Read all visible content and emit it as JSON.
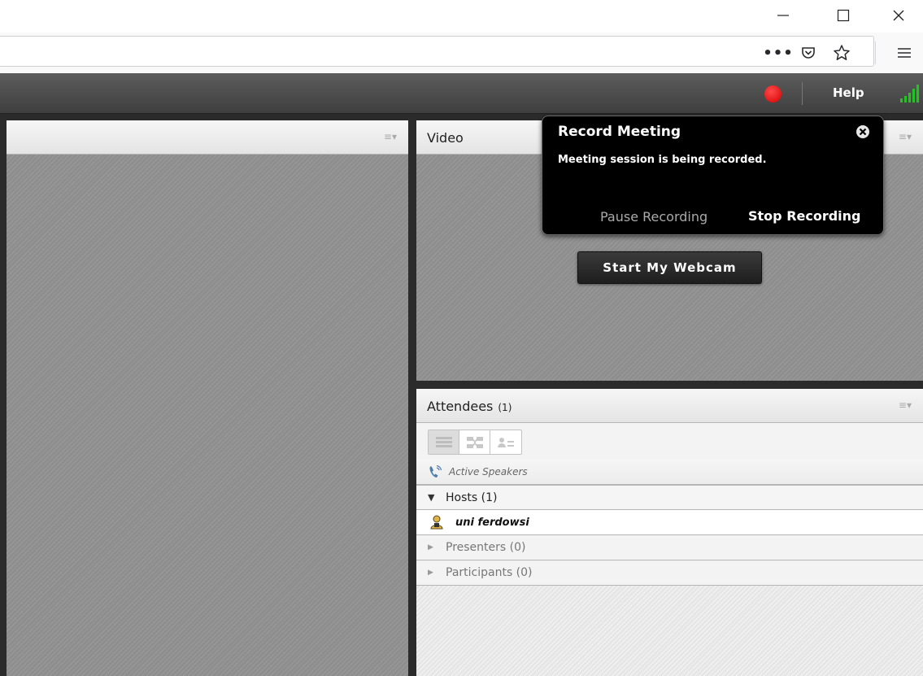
{
  "window": {
    "minimize_icon": "minimize-icon",
    "maximize_icon": "maximize-icon",
    "close_icon": "close-icon"
  },
  "browser_toolbar": {
    "url_value": "",
    "more_label": "•••",
    "icons": [
      "page-actions-icon",
      "pocket-icon",
      "bookmark-star-icon",
      "hamburger-menu-icon"
    ]
  },
  "app_bar": {
    "help_label": "Help",
    "recording_indicator_color": "#e00000",
    "signal_color": "#22c322"
  },
  "pods": {
    "share": {
      "title": ""
    },
    "video": {
      "title": "Video",
      "webcam_button": "Start My Webcam"
    },
    "attendees": {
      "title": "Attendees",
      "count": "(1)",
      "active_speakers": "Active Speakers",
      "groups": [
        {
          "label": "Hosts (1)",
          "expanded": true
        },
        {
          "label": "Presenters (0)",
          "expanded": false
        },
        {
          "label": "Participants (0)",
          "expanded": false
        }
      ],
      "hosts": [
        {
          "name": "uni ferdowsi"
        }
      ]
    }
  },
  "record_popup": {
    "title": "Record Meeting",
    "message": "Meeting session is being recorded.",
    "pause_label": "Pause Recording",
    "stop_label": "Stop Recording"
  }
}
